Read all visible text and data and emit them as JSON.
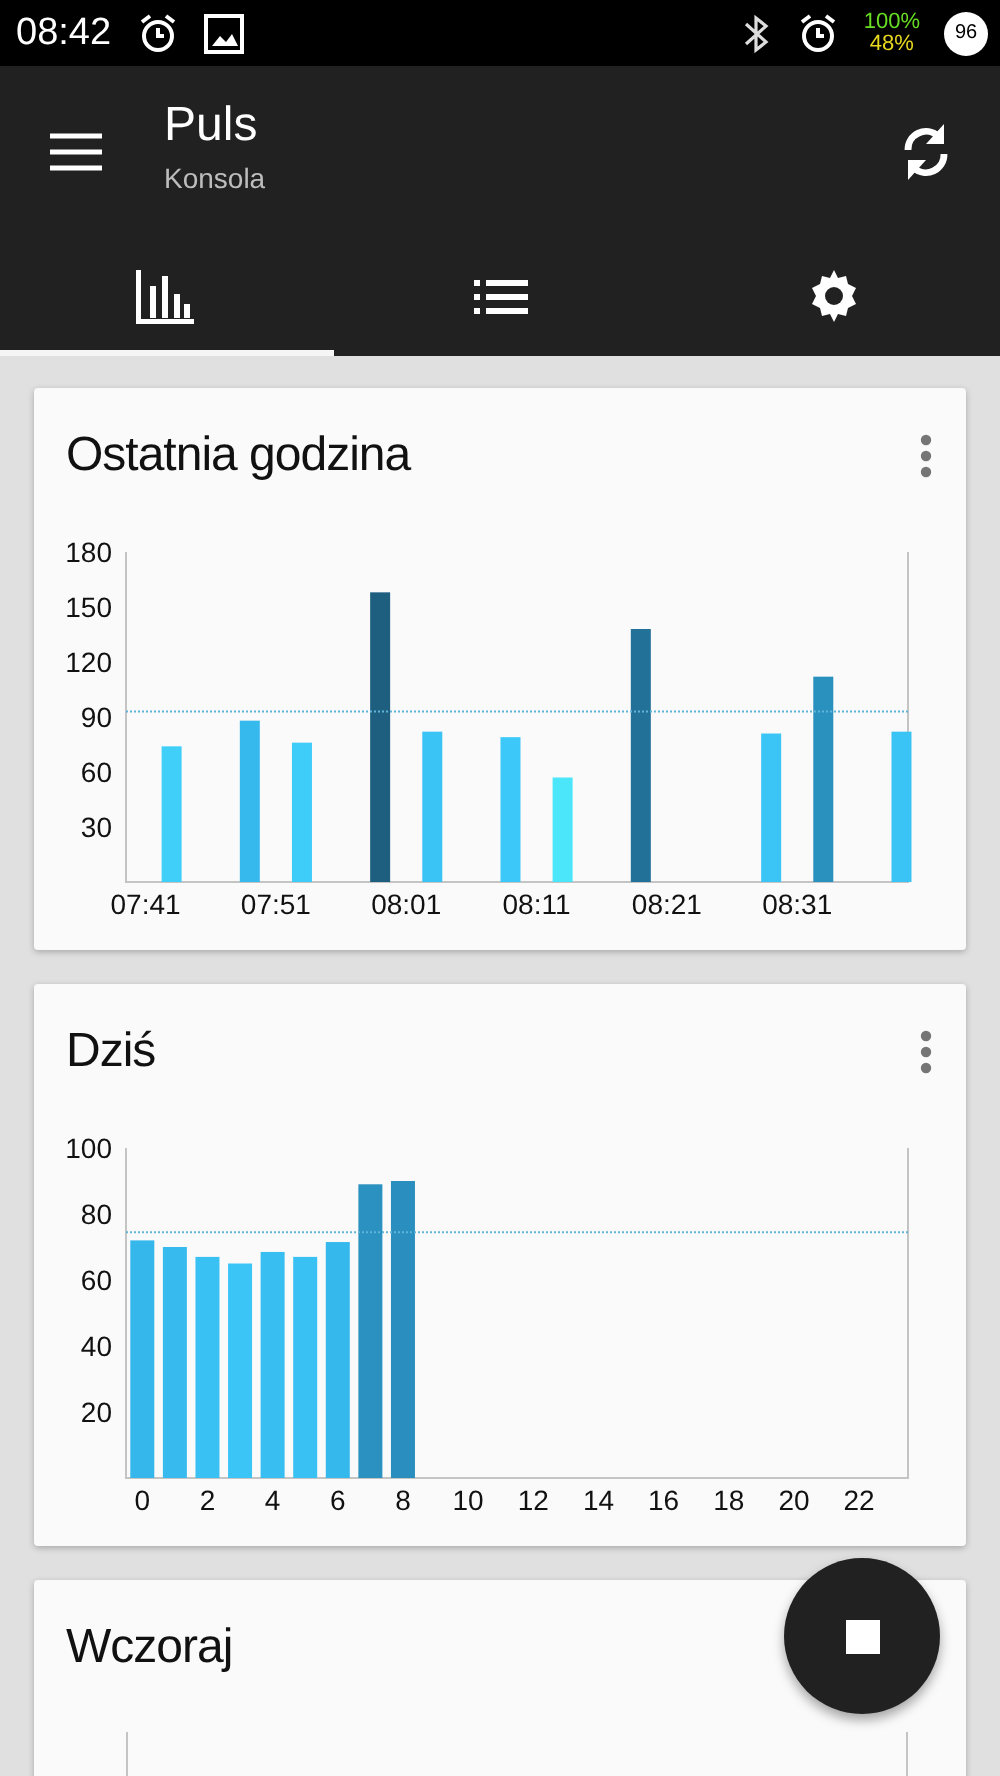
{
  "status_bar": {
    "time": "08:42",
    "battery_charge": "100%",
    "battery_level": "48%",
    "badge": "96"
  },
  "app_bar": {
    "title": "Puls",
    "subtitle": "Konsola"
  },
  "tabs": [
    {
      "selected": true
    },
    {
      "selected": false
    },
    {
      "selected": false
    }
  ],
  "cards": [
    {
      "title": "Ostatnia godzina",
      "chart_data": {
        "type": "bar",
        "categories": [
          null,
          "07:41",
          null,
          null,
          null,
          null,
          null,
          null,
          null,
          null,
          null,
          "07:51",
          null,
          null,
          null,
          null,
          null,
          null,
          null,
          null,
          null,
          "08:01",
          null,
          null,
          null,
          null,
          null,
          null,
          null,
          null,
          null,
          "08:11",
          null,
          null,
          null,
          null,
          null,
          null,
          null,
          null,
          null,
          "08:21",
          null,
          null,
          null,
          null,
          null,
          null,
          null,
          null,
          null,
          "08:31",
          null,
          null,
          null,
          null,
          null,
          null,
          null,
          null
        ],
        "series": [
          {
            "values": [
              null,
              null,
              null,
              74,
              null,
              null,
              null,
              null,
              null,
              88,
              null,
              null,
              null,
              76,
              null,
              null,
              null,
              null,
              null,
              158,
              null,
              null,
              null,
              82,
              null,
              null,
              null,
              null,
              null,
              79,
              null,
              null,
              null,
              57,
              null,
              null,
              null,
              null,
              null,
              138,
              null,
              null,
              null,
              null,
              null,
              null,
              null,
              null,
              null,
              81,
              null,
              null,
              null,
              112,
              null,
              null,
              null,
              null,
              null,
              82
            ]
          }
        ],
        "ylim": [
          0,
          180
        ],
        "yticks": [
          30,
          60,
          90,
          120,
          150,
          180
        ],
        "ref_lines": [
          {
            "axis": "y",
            "value": 93
          }
        ]
      }
    },
    {
      "title": "Dziś",
      "chart_data": {
        "type": "bar",
        "categories": [
          "0",
          null,
          "2",
          null,
          "4",
          null,
          "6",
          null,
          "8",
          null,
          "10",
          null,
          "12",
          null,
          "14",
          null,
          "16",
          null,
          "18",
          null,
          "20",
          null,
          "22",
          null
        ],
        "series": [
          {
            "values": [
              72,
              70,
              67,
              65,
              68.5,
              67,
              71.5,
              89,
              90,
              null,
              null,
              null,
              null,
              null,
              null,
              null,
              null,
              null,
              null,
              null,
              null,
              null,
              null,
              null
            ]
          }
        ],
        "ylim": [
          0,
          100
        ],
        "yticks": [
          20,
          40,
          60,
          80,
          100
        ],
        "ref_lines": [
          {
            "axis": "y",
            "value": 74.5
          }
        ]
      }
    },
    {
      "title": "Wczoraj"
    }
  ]
}
